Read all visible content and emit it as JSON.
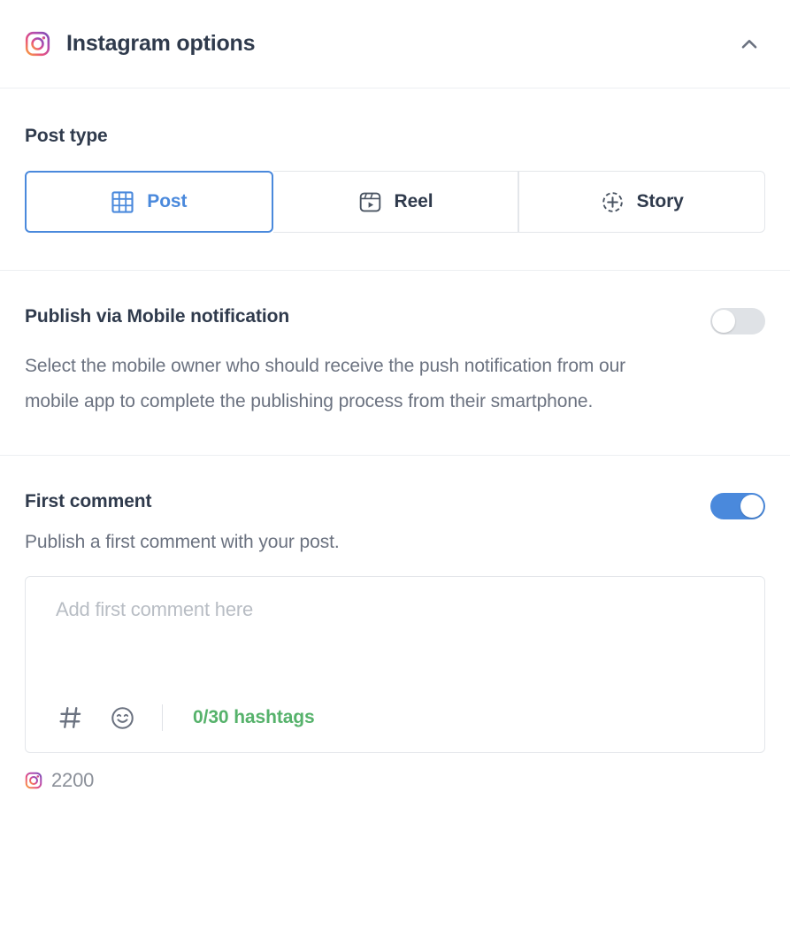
{
  "header": {
    "title": "Instagram options",
    "brand_icon": "instagram-icon",
    "collapse_icon": "chevron-up-icon"
  },
  "post_type": {
    "label": "Post type",
    "tabs": [
      {
        "label": "Post",
        "icon": "grid-icon",
        "selected": true
      },
      {
        "label": "Reel",
        "icon": "reel-icon",
        "selected": false
      },
      {
        "label": "Story",
        "icon": "circle-plus-icon",
        "selected": false
      }
    ]
  },
  "mobile_notification": {
    "title": "Publish via Mobile notification",
    "description": "Select the mobile owner who should receive the push notification from our mobile app to complete the publishing process from their smartphone.",
    "toggle_state": "off"
  },
  "first_comment": {
    "title": "First comment",
    "description": "Publish a first comment with your post.",
    "toggle_state": "on",
    "input_value": "",
    "placeholder": "Add first comment here",
    "toolbar": {
      "hashtag_icon": "hashtag-icon",
      "emoji_icon": "emoji-smiley-icon",
      "hashtag_count": "0/30 hashtags"
    }
  },
  "footer_counter": {
    "icon": "instagram-icon",
    "value": "2200"
  },
  "colors": {
    "accent_blue": "#4a89dc",
    "heading": "#2f3a4c",
    "body_text": "#6b7280",
    "green": "#56b26b",
    "border": "#e3e6ea",
    "divider": "#edeff2",
    "toggle_off": "#dfe2e6"
  }
}
